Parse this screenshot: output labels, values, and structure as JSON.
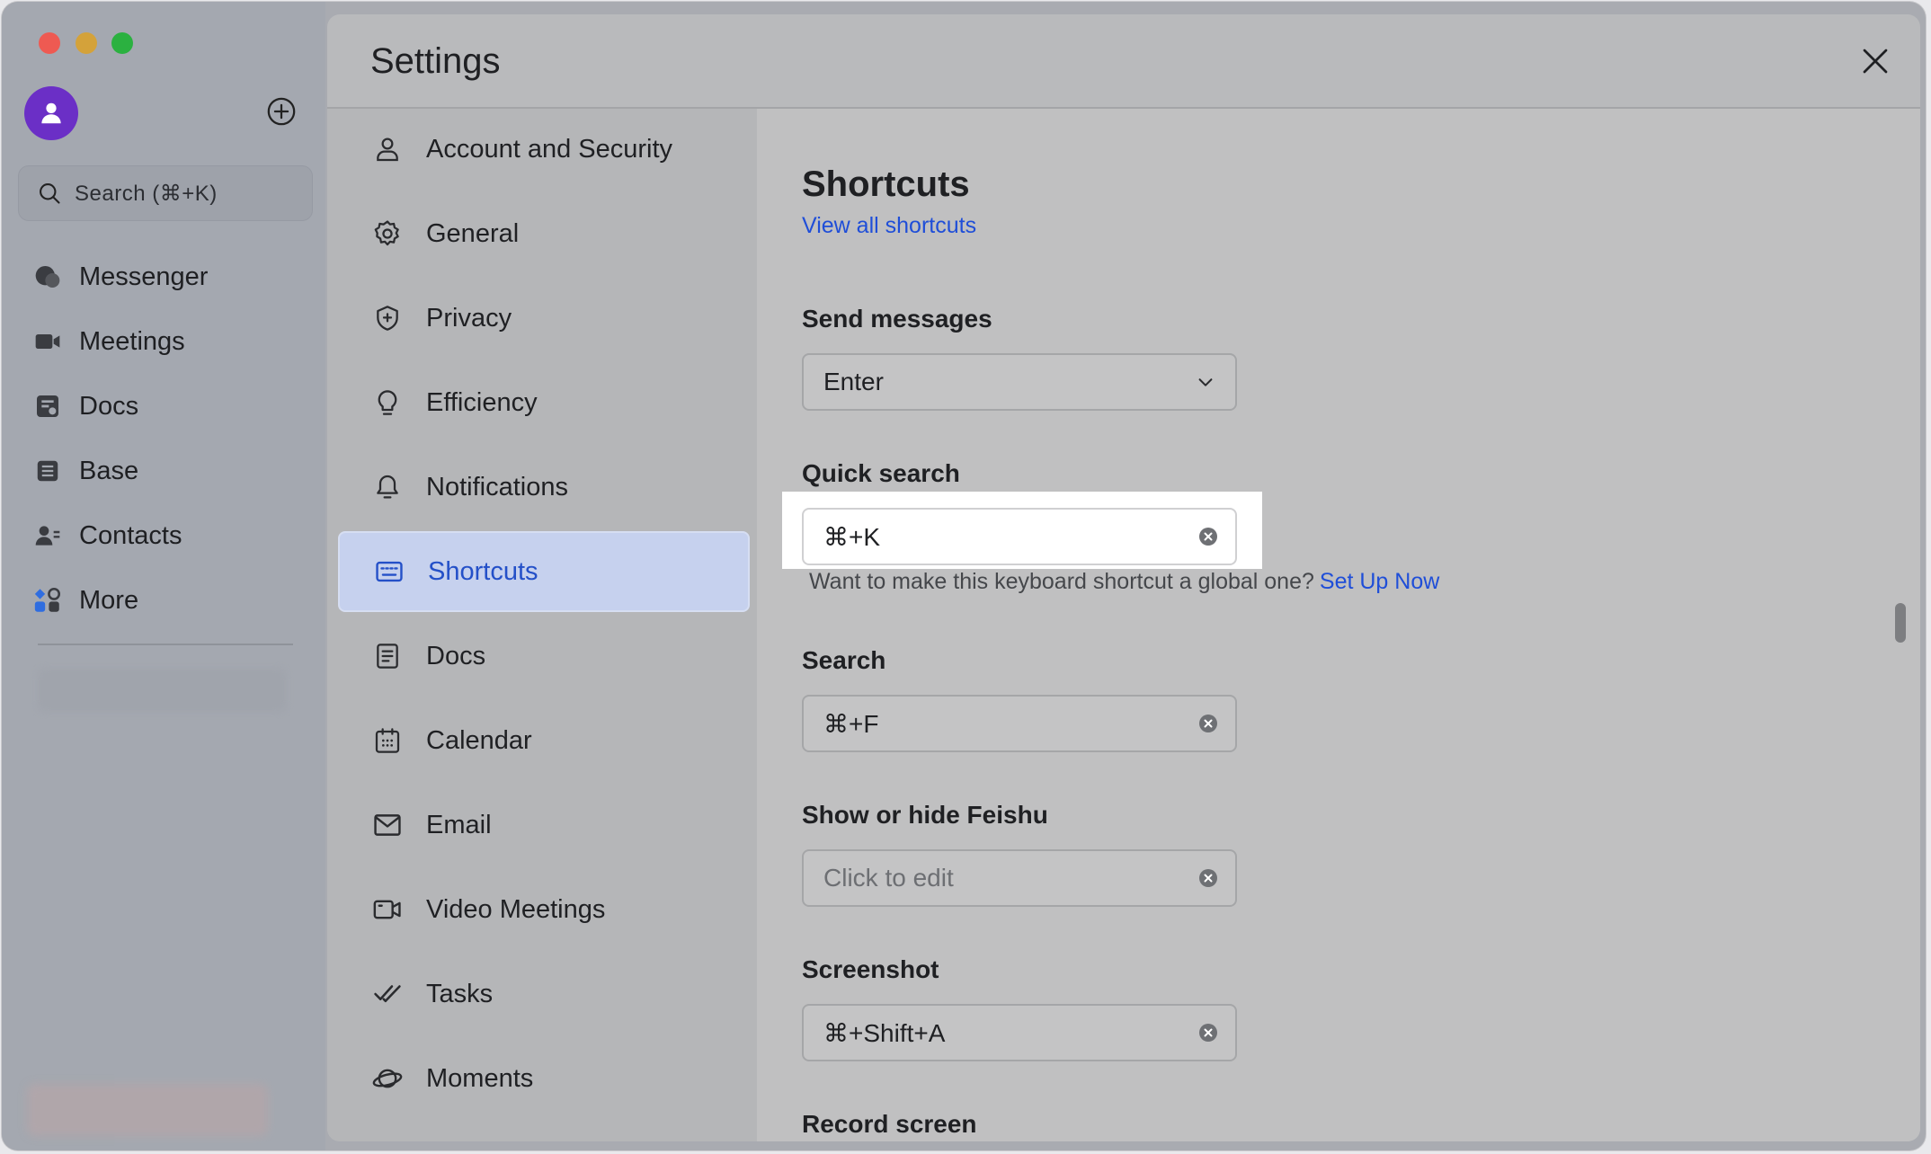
{
  "app": {
    "search_placeholder": "Search (⌘+K)",
    "nav": [
      {
        "label": "Messenger",
        "icon": "messenger-icon"
      },
      {
        "label": "Meetings",
        "icon": "video-camera-icon"
      },
      {
        "label": "Docs",
        "icon": "docs-icon"
      },
      {
        "label": "Base",
        "icon": "base-icon"
      },
      {
        "label": "Contacts",
        "icon": "contacts-icon"
      },
      {
        "label": "More",
        "icon": "more-apps-icon"
      }
    ]
  },
  "settings": {
    "title": "Settings",
    "categories": [
      {
        "label": "Account and Security",
        "icon": "person-icon"
      },
      {
        "label": "General",
        "icon": "gear-icon"
      },
      {
        "label": "Privacy",
        "icon": "shield-icon"
      },
      {
        "label": "Efficiency",
        "icon": "lightbulb-icon"
      },
      {
        "label": "Notifications",
        "icon": "bell-icon"
      },
      {
        "label": "Shortcuts",
        "icon": "keyboard-icon",
        "active": true
      },
      {
        "label": "Docs",
        "icon": "document-icon"
      },
      {
        "label": "Calendar",
        "icon": "calendar-icon"
      },
      {
        "label": "Email",
        "icon": "envelope-icon"
      },
      {
        "label": "Video Meetings",
        "icon": "video-icon"
      },
      {
        "label": "Tasks",
        "icon": "check-icon"
      },
      {
        "label": "Moments",
        "icon": "planet-icon"
      }
    ],
    "shortcuts": {
      "title": "Shortcuts",
      "view_all": "View all shortcuts",
      "send_messages": {
        "label": "Send messages",
        "value": "Enter"
      },
      "quick_search": {
        "label": "Quick search",
        "value": "⌘+K",
        "hint": "Want to make this keyboard shortcut a global one?",
        "hint_link": "Set Up Now"
      },
      "search": {
        "label": "Search",
        "value": "⌘+F"
      },
      "show_hide": {
        "label": "Show or hide Feishu",
        "placeholder": "Click to edit"
      },
      "screenshot": {
        "label": "Screenshot",
        "value": "⌘+Shift+A"
      },
      "record_screen": {
        "label": "Record screen"
      }
    }
  },
  "colors": {
    "accent": "#1f4ed8",
    "active_bg": "#c6d1ee",
    "avatar": "#6b2fc6"
  }
}
